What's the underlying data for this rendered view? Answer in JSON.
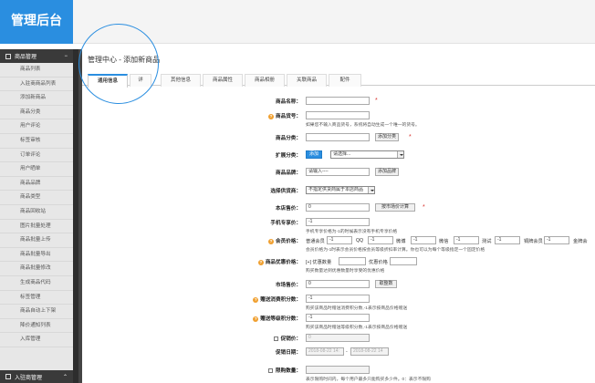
{
  "app": {
    "title": "管理后台"
  },
  "sidebar": {
    "group_label": "商品管理",
    "items": [
      "商品列表",
      "入驻商商品列表",
      "添加新商品",
      "商品分类",
      "用户评论",
      "标签审核",
      "订单评论",
      "用户晒单",
      "商品品牌",
      "商品类型",
      "商品回收站",
      "图片批量处理",
      "商品批量上传",
      "商品批量导出",
      "商品批量修改",
      "生成商品代码",
      "标签管理",
      "商品自动上下架",
      "降价通知列表",
      "入库管理"
    ],
    "bottom_label": "入驻商管理"
  },
  "page": {
    "title": "管理中心 - 添加新商品"
  },
  "tabs": [
    "通用信息",
    "详",
    "其他信息",
    "商品属性",
    "商品相册",
    "关联商品",
    "配件"
  ],
  "form": {
    "name_label": "商品名称：",
    "sn_label": "商品货号：",
    "sn_note": "如果您不输入商品货号，系统将自动生成一个唯一的货号。",
    "cat_label": "商品分类：",
    "cat_btn": "添加分类",
    "ext_label": "扩展分类：",
    "ext_btn": "添加",
    "ext_select": "请选择...",
    "brand_label": "商品品牌：",
    "brand_value": "请输入----",
    "brand_btn": "添加品牌",
    "supplier_label": "选择供货商：",
    "supplier_value": "不指定供货商属于本店商品",
    "price_label": "本店售价：",
    "price_value": "0",
    "price_btn": "按市场价计算",
    "phone_label": "手机专享价：",
    "phone_value": "-1",
    "phone_note": "手机专享价格为-1的时候表示没有手机专享价格",
    "member_label": "会员价格：",
    "member_levels": [
      {
        "name": "普通会员",
        "value": "-1"
      },
      {
        "name": "QQ",
        "value": "-1"
      },
      {
        "name": "微博",
        "value": "-1"
      },
      {
        "name": "微信",
        "value": "-1"
      },
      {
        "name": "测试",
        "value": "-1"
      },
      {
        "name": "铜牌会员",
        "value": "-1"
      },
      {
        "name": "金牌会"
      }
    ],
    "member_note": "会员价格为-1时表示会员价格按会员等级折扣率计算。你也可以为每个等级指定一个固定价格",
    "discount_label": "商品优惠价格：",
    "discount_plus": "[+]",
    "discount_qty": "优惠数量",
    "discount_price": "优惠价格",
    "discount_note": "购买数量达到优惠数量时享受的优惠价格",
    "market_label": "市场售价：",
    "market_value": "0",
    "market_btn": "取整数",
    "consume_label": "赠送消费积分数：",
    "consume_value": "-1",
    "consume_note": "购买该商品时赠送消费积分数,-1表示按商品价格赠送",
    "rank_label": "赠送等级积分数：",
    "rank_value": "-1",
    "rank_note": "购买该商品时赠送等级积分数,-1表示按商品价格赠送",
    "promote_label": "促销价：",
    "promote_value": "0",
    "promote_date_label": "促销日期：",
    "promote_start": "2018-08-22 14:",
    "promote_end": "2018-08-22 14",
    "limit_label": "限购数量：",
    "limit_note": "表示限购时间内，每个用户最多只能购买多少件。0：表示不限购"
  },
  "colors": {
    "brand": "#2a8ee0",
    "sidebar_dark": "#3a3a3a",
    "required": "#d9332e",
    "hint_icon": "#f0a030"
  }
}
